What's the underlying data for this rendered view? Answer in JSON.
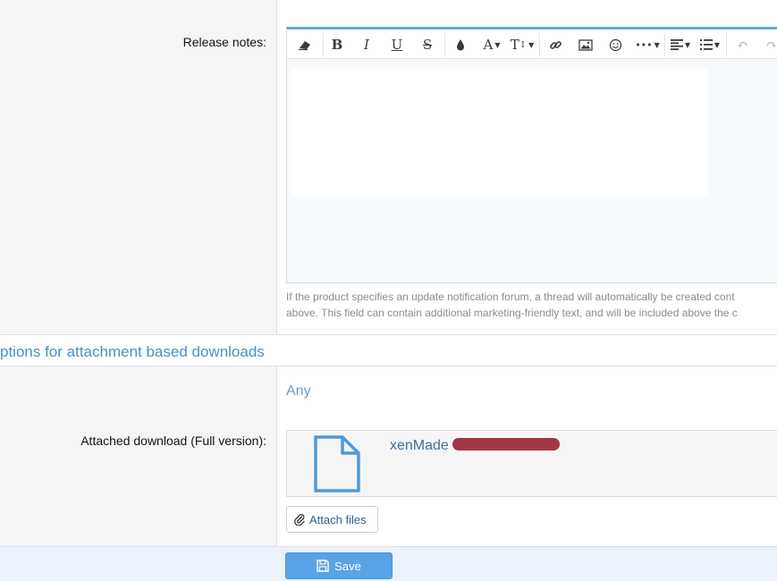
{
  "fields": {
    "release_notes_label": "Release notes:",
    "attached_download_label": "Attached download (Full version):"
  },
  "editor": {
    "toolbar": [
      {
        "name": "remove-format-icon",
        "glyph": "⌫",
        "disabled": false
      },
      {
        "name": "bold-icon",
        "glyph": "B",
        "disabled": false
      },
      {
        "name": "italic-icon",
        "glyph": "I",
        "disabled": false
      },
      {
        "name": "underline-icon",
        "glyph": "U",
        "disabled": false
      },
      {
        "name": "strikethrough-icon",
        "glyph": "S",
        "disabled": false
      },
      {
        "name": "text-color-icon",
        "glyph": "●",
        "disabled": false
      },
      {
        "name": "font-family-icon",
        "glyph": "A",
        "disabled": false
      },
      {
        "name": "font-size-icon",
        "glyph": "T",
        "disabled": false
      },
      {
        "name": "link-icon",
        "glyph": "🔗",
        "disabled": false
      },
      {
        "name": "image-icon",
        "glyph": "▣",
        "disabled": false
      },
      {
        "name": "emoji-icon",
        "glyph": "☺",
        "disabled": false
      },
      {
        "name": "more-options-icon",
        "glyph": "•••",
        "disabled": false
      },
      {
        "name": "align-icon",
        "glyph": "≡",
        "disabled": false
      },
      {
        "name": "list-icon",
        "glyph": "☰",
        "disabled": false
      },
      {
        "name": "undo-icon",
        "glyph": "↶",
        "disabled": true
      },
      {
        "name": "redo-icon",
        "glyph": "↷",
        "disabled": true
      }
    ],
    "hint_line1": "If the product specifies an update notification forum, a thread will automatically be created cont",
    "hint_line2": "above. This field can contain additional marketing-friendly text, and will be included above the c"
  },
  "section": {
    "title": "ptions for attachment based downloads"
  },
  "attachment": {
    "any_text": "Any",
    "file_name": "xenMade",
    "attach_button": "Attach files"
  },
  "footer": {
    "save_label": "Save"
  },
  "colors": {
    "accent": "#5aa3e6",
    "section_title": "#4a8ec8",
    "redaction": "#9b2c3a"
  }
}
